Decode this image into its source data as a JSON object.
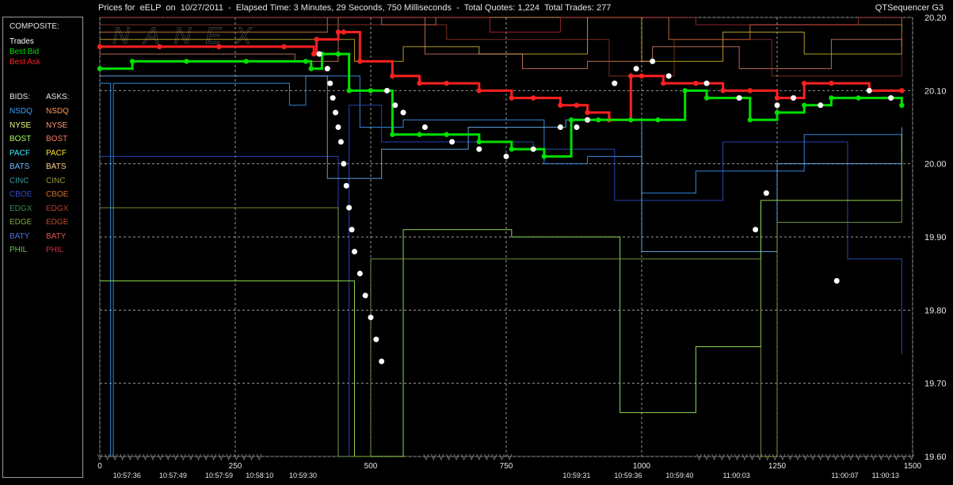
{
  "title": {
    "symbol_prefix": "Prices for  eELP  on  10/27/2011",
    "elapsed": "Elapsed Time: 3 Minutes, 29 Seconds, 750 Milliseconds",
    "totals": "Total Quotes: 1,224  Total Trades: 277",
    "app": "QTSequencer G3"
  },
  "watermark": "NANEX",
  "legend": {
    "composite_heading": "COMPOSITE:",
    "composite": [
      {
        "label": "Trades",
        "color": "#ffffff"
      },
      {
        "label": "Best Bid",
        "color": "#00e000"
      },
      {
        "label": "Best Ask",
        "color": "#ff2020"
      }
    ],
    "bids_heading": "BIDS:",
    "asks_heading": "ASKS:",
    "exchanges": [
      {
        "bid": "NSDQ",
        "ask": "NSDQ",
        "bid_color": "#3aa0ff",
        "ask_color": "#ff9a50"
      },
      {
        "bid": "NYSE",
        "ask": "NYSE",
        "bid_color": "#e8ff80",
        "ask_color": "#ff9a7a"
      },
      {
        "bid": "BOST",
        "ask": "BOST",
        "bid_color": "#a8ff60",
        "ask_color": "#ff7a60"
      },
      {
        "bid": "PACF",
        "ask": "PACF",
        "bid_color": "#30f0ff",
        "ask_color": "#ffe030"
      },
      {
        "bid": "BATS",
        "ask": "BATS",
        "bid_color": "#70b8ff",
        "ask_color": "#ffd090"
      },
      {
        "bid": "CINC",
        "ask": "CINC",
        "bid_color": "#3a9a9a",
        "ask_color": "#9a9a3a"
      },
      {
        "bid": "CBOE",
        "ask": "CBOE",
        "bid_color": "#3050d0",
        "ask_color": "#d07030"
      },
      {
        "bid": "EDGX",
        "ask": "EDGX",
        "bid_color": "#3a8a50",
        "ask_color": "#b04030"
      },
      {
        "bid": "EDGE",
        "ask": "EDGE",
        "bid_color": "#80a840",
        "ask_color": "#c04a30"
      },
      {
        "bid": "BATY",
        "ask": "BATY",
        "bid_color": "#5070e0",
        "ask_color": "#e05050"
      },
      {
        "bid": "PHIL",
        "ask": "PHIL",
        "bid_color": "#70c050",
        "ask_color": "#d03040"
      }
    ]
  },
  "chart_data": {
    "type": "line",
    "xlabel": "",
    "ylabel": "",
    "xlim": [
      0,
      1500
    ],
    "ylim": [
      19.6,
      20.2
    ],
    "y_ticks": [
      "20.20",
      "20.10",
      "20.00",
      "19.90",
      "19.80",
      "19.70",
      "19.60"
    ],
    "x_ticks": [
      "0",
      "250",
      "500",
      "750",
      "1000",
      "1250",
      "1500"
    ],
    "time_labels": [
      {
        "x": 50,
        "label": "10:57:36"
      },
      {
        "x": 135,
        "label": "10:57:49"
      },
      {
        "x": 220,
        "label": "10:57:59"
      },
      {
        "x": 295,
        "label": "10:58:10"
      },
      {
        "x": 375,
        "label": "10:59:30"
      },
      {
        "x": 880,
        "label": "10:59:31"
      },
      {
        "x": 975,
        "label": "10:59:36"
      },
      {
        "x": 1070,
        "label": "10:59:40"
      },
      {
        "x": 1175,
        "label": "11:00:03"
      },
      {
        "x": 1375,
        "label": "11:00:07"
      },
      {
        "x": 1450,
        "label": "11:00:13"
      }
    ],
    "grid": true,
    "series": [
      {
        "name": "Best Ask",
        "color": "#ff2020",
        "points": [
          [
            0,
            20.16
          ],
          [
            110,
            20.16
          ],
          [
            220,
            20.16
          ],
          [
            340,
            20.16
          ],
          [
            395,
            20.15
          ],
          [
            400,
            20.17
          ],
          [
            440,
            20.18
          ],
          [
            450,
            20.18
          ],
          [
            480,
            20.14
          ],
          [
            540,
            20.12
          ],
          [
            590,
            20.11
          ],
          [
            640,
            20.11
          ],
          [
            700,
            20.1
          ],
          [
            760,
            20.09
          ],
          [
            800,
            20.09
          ],
          [
            850,
            20.08
          ],
          [
            880,
            20.08
          ],
          [
            900,
            20.07
          ],
          [
            940,
            20.06
          ],
          [
            980,
            20.12
          ],
          [
            1000,
            20.12
          ],
          [
            1040,
            20.11
          ],
          [
            1100,
            20.11
          ],
          [
            1150,
            20.1
          ],
          [
            1200,
            20.1
          ],
          [
            1250,
            20.09
          ],
          [
            1300,
            20.11
          ],
          [
            1350,
            20.11
          ],
          [
            1420,
            20.1
          ],
          [
            1480,
            20.1
          ]
        ]
      },
      {
        "name": "Best Bid",
        "color": "#00e000",
        "points": [
          [
            0,
            20.13
          ],
          [
            60,
            20.14
          ],
          [
            160,
            20.14
          ],
          [
            270,
            20.14
          ],
          [
            380,
            20.14
          ],
          [
            390,
            20.13
          ],
          [
            410,
            20.15
          ],
          [
            440,
            20.15
          ],
          [
            460,
            20.1
          ],
          [
            500,
            20.1
          ],
          [
            540,
            20.04
          ],
          [
            590,
            20.04
          ],
          [
            640,
            20.04
          ],
          [
            700,
            20.03
          ],
          [
            760,
            20.02
          ],
          [
            820,
            20.01
          ],
          [
            870,
            20.06
          ],
          [
            920,
            20.06
          ],
          [
            980,
            20.06
          ],
          [
            1030,
            20.06
          ],
          [
            1080,
            20.1
          ],
          [
            1120,
            20.09
          ],
          [
            1200,
            20.06
          ],
          [
            1250,
            20.07
          ],
          [
            1300,
            20.08
          ],
          [
            1350,
            20.09
          ],
          [
            1400,
            20.09
          ],
          [
            1480,
            20.08
          ]
        ]
      },
      {
        "name": "Trades",
        "color": "#ffffff",
        "points": [
          [
            405,
            20.15
          ],
          [
            420,
            20.13
          ],
          [
            425,
            20.11
          ],
          [
            430,
            20.09
          ],
          [
            435,
            20.07
          ],
          [
            440,
            20.05
          ],
          [
            445,
            20.03
          ],
          [
            450,
            20.0
          ],
          [
            455,
            19.97
          ],
          [
            460,
            19.94
          ],
          [
            465,
            19.91
          ],
          [
            470,
            19.88
          ],
          [
            480,
            19.85
          ],
          [
            490,
            19.82
          ],
          [
            500,
            19.79
          ],
          [
            510,
            19.76
          ],
          [
            520,
            19.73
          ],
          [
            530,
            20.1
          ],
          [
            545,
            20.08
          ],
          [
            560,
            20.07
          ],
          [
            600,
            20.05
          ],
          [
            650,
            20.03
          ],
          [
            700,
            20.02
          ],
          [
            750,
            20.01
          ],
          [
            800,
            20.02
          ],
          [
            850,
            20.05
          ],
          [
            880,
            20.05
          ],
          [
            900,
            20.06
          ],
          [
            950,
            20.11
          ],
          [
            990,
            20.13
          ],
          [
            1020,
            20.14
          ],
          [
            1050,
            20.12
          ],
          [
            1120,
            20.11
          ],
          [
            1180,
            20.09
          ],
          [
            1210,
            19.91
          ],
          [
            1230,
            19.96
          ],
          [
            1250,
            20.08
          ],
          [
            1280,
            20.09
          ],
          [
            1330,
            20.08
          ],
          [
            1360,
            19.84
          ],
          [
            1420,
            20.1
          ],
          [
            1460,
            20.09
          ]
        ]
      }
    ]
  }
}
